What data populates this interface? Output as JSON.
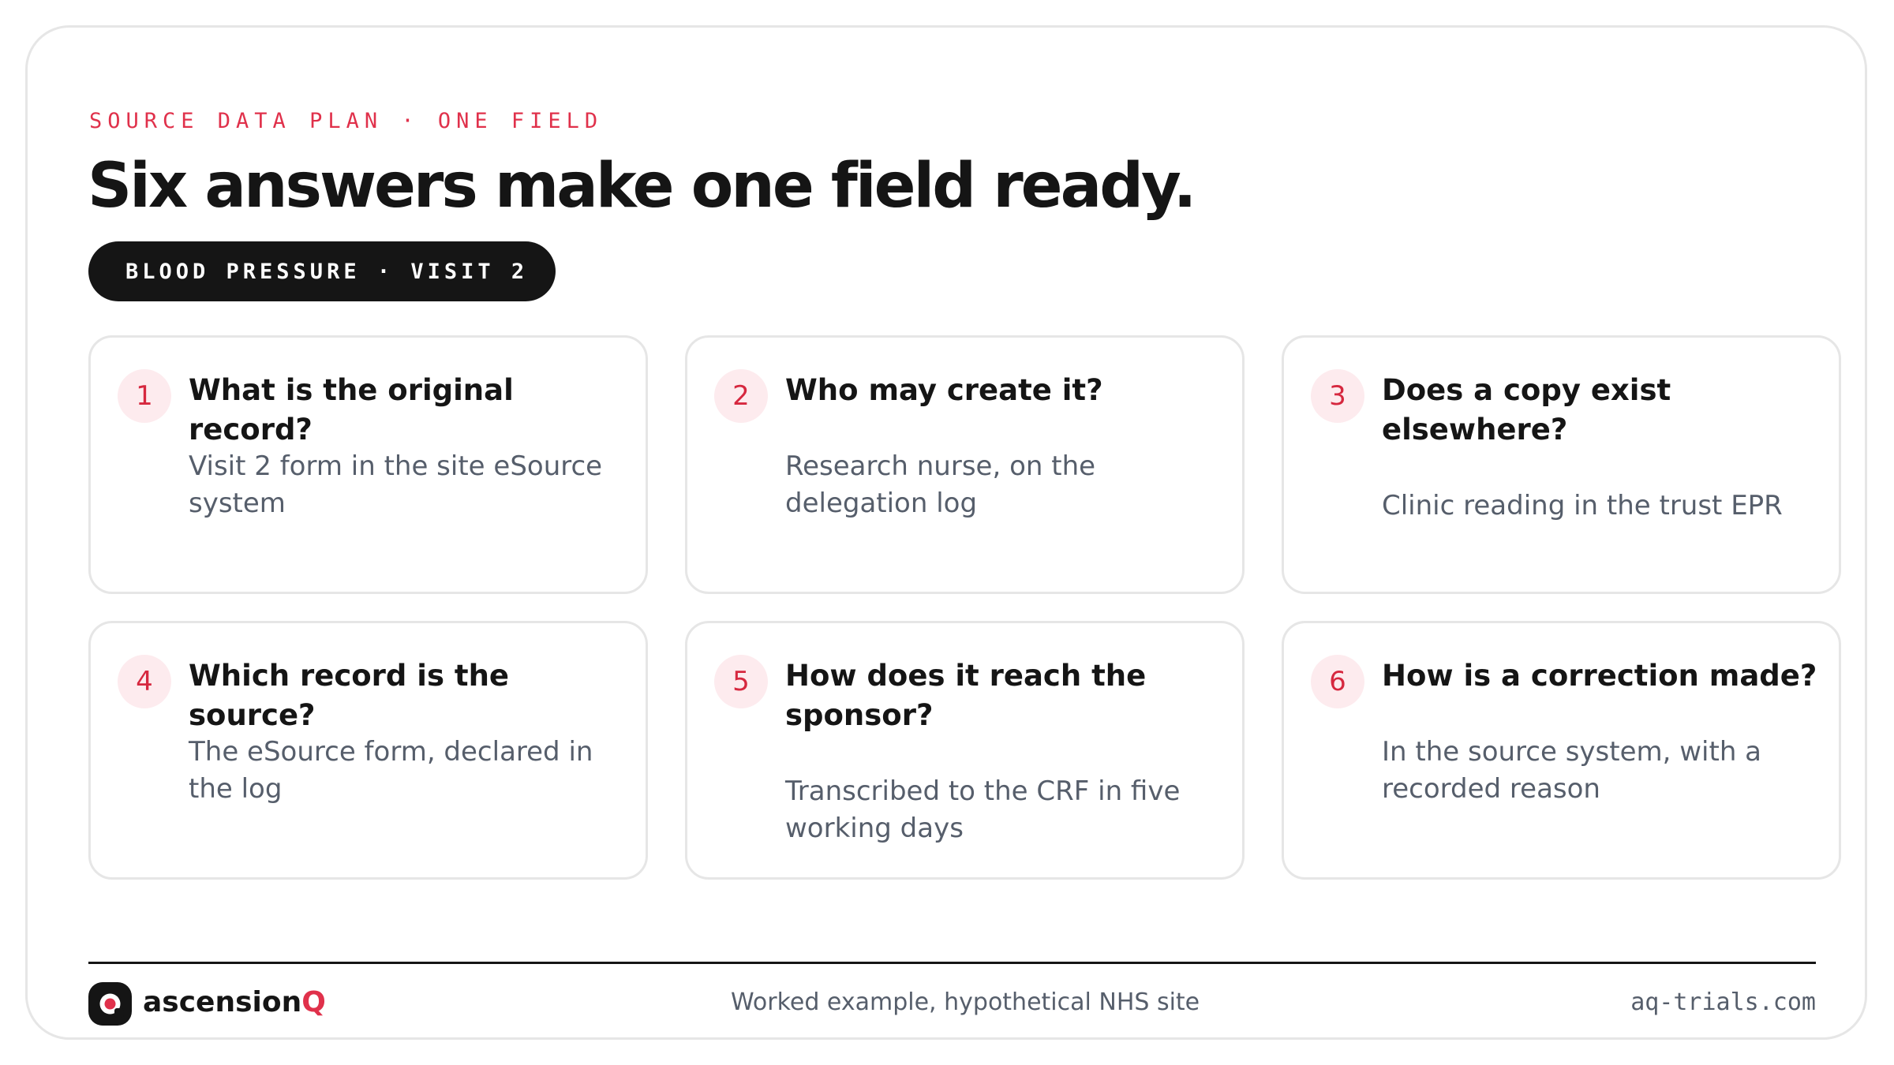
{
  "eyebrow": "SOURCE DATA PLAN · ONE FIELD",
  "headline": "Six answers make one field ready.",
  "field_pill": "BLOOD PRESSURE · VISIT 2",
  "cards": [
    {
      "number": "1",
      "question": "What is the original record?",
      "answer": "Visit 2 form in the site eSource system"
    },
    {
      "number": "2",
      "question": "Who may create it?",
      "answer": "Research nurse, on the delegation log"
    },
    {
      "number": "3",
      "question": "Does a copy exist elsewhere?",
      "answer": "Clinic reading in the trust EPR"
    },
    {
      "number": "4",
      "question": "Which record is the source?",
      "answer": "The eSource form, declared in the log"
    },
    {
      "number": "5",
      "question": "How does it reach the sponsor?",
      "answer": "Transcribed to the CRF in five working days"
    },
    {
      "number": "6",
      "question": "How is a correction made?",
      "answer": "In the source system, with a recorded reason"
    }
  ],
  "footer": {
    "brand_main": "ascension",
    "brand_accent": "Q",
    "note": "Worked example, hypothetical NHS site",
    "url": "aq-trials.com",
    "logo_icon": "ascensionq-logo-icon"
  },
  "colors": {
    "accent": "#e0314b",
    "dark": "#151515",
    "muted_text": "#565e6b",
    "badge_bg": "#fdebee",
    "card_border": "#e6e6e6"
  }
}
